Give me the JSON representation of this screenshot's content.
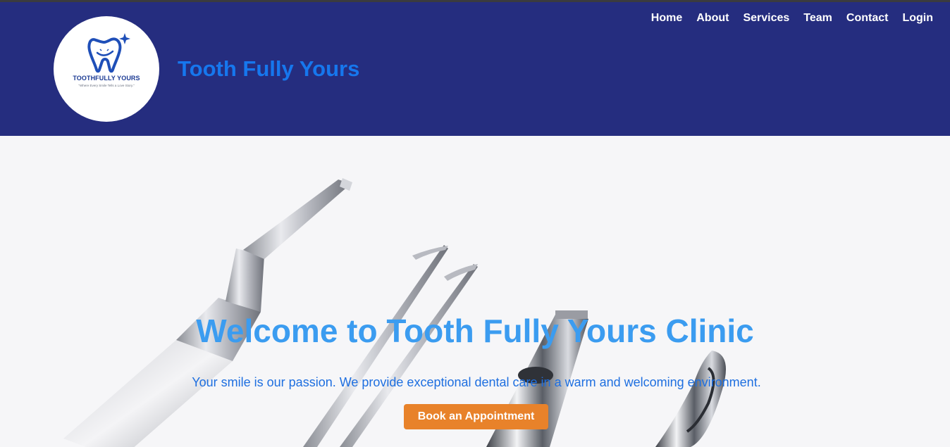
{
  "header": {
    "site_title": "Tooth Fully Yours",
    "logo": {
      "name": "TOOTHFULLY YOURS",
      "tagline": "\"Where Every Smile Tells a Love Story.\""
    }
  },
  "nav": {
    "items": [
      "Home",
      "About",
      "Services",
      "Team",
      "Contact",
      "Login"
    ]
  },
  "hero": {
    "title": "Welcome to Tooth Fully Yours Clinic",
    "subtitle": "Your smile is our passion. We provide exceptional dental care in a warm and welcoming environment.",
    "cta_label": "Book an Appointment"
  },
  "colors": {
    "header_bg": "#252d7f",
    "title_blue": "#1677ee",
    "hero_title": "#3b9cf0",
    "cta_orange": "#e8822a"
  },
  "icons": [
    "tooth-logo-icon",
    "sparkle-icon"
  ]
}
